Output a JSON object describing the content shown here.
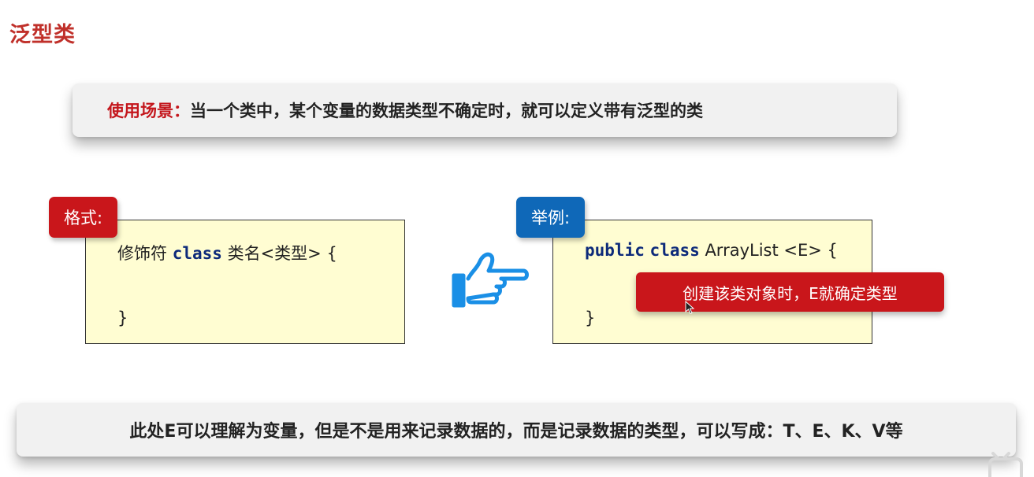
{
  "page": {
    "title": "泛型类"
  },
  "usage": {
    "key": "使用场景：",
    "text": "当一个类中，某个变量的数据类型不确定时，就可以定义带有泛型的类"
  },
  "format": {
    "tag": "格式:",
    "line1_prefix": "修饰符 ",
    "line1_keyword": "class",
    "line1_suffix": " 类名<类型> {",
    "line2": "}"
  },
  "example": {
    "tag": "举例:",
    "kw_public": "public",
    "kw_class": "class",
    "line1_suffix": " ArrayList <E> {",
    "line2": "}",
    "tooltip": "创建该类对象时，E就确定类型"
  },
  "note": {
    "text": "此处E可以理解为变量，但是不是用来记录数据的，而是记录数据的类型，可以写成：T、E、K、V等"
  },
  "icons": {
    "hand": "pointing-hand-icon",
    "cursor": "mouse-cursor-icon",
    "logo": "video-site-logo-icon"
  },
  "colors": {
    "title_red": "#c0302a",
    "tag_red": "#c9161b",
    "tag_blue": "#0f68b8",
    "code_bg": "#fffdd2",
    "keyword_navy": "#0d2a7a",
    "hand_blue": "#1a8fe6"
  }
}
